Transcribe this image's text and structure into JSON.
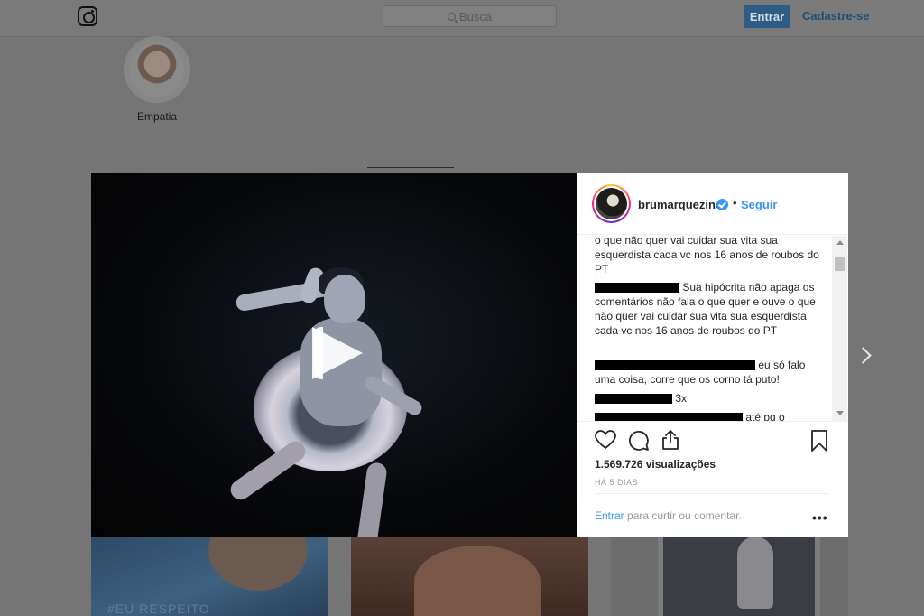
{
  "header": {
    "search_placeholder": "Busca",
    "login_label": "Entrar",
    "signup_label": "Cadastre-se"
  },
  "highlight": {
    "label": "Empatia"
  },
  "post": {
    "username": "brumarquezine",
    "separator": "•",
    "follow_label": "Seguir",
    "comments": [
      {
        "text": "o que não quer vai cuidar sua vita sua esquerdista cada vc nos 16 anos de roubos do PT"
      },
      {
        "text": "Sua hipócrita não apaga os comentários não fala o que quer e ouve o que não quer vai cuidar sua vita sua esquerdista cada vc nos 16 anos de roubos do PT"
      },
      {
        "text": "eu só falo uma coisa, corre que os corno tá puto!"
      },
      {
        "text": "3x"
      },
      {
        "text": "até pq o"
      }
    ],
    "views": "1.569.726 visualizações",
    "date": "HÁ 5 DIAS",
    "login_prompt_link": "Entrar",
    "login_prompt_rest": "para curtir ou comentar.",
    "more_label": "•••"
  },
  "thumbnails": [
    {
      "caption": "#EU RESPEITO"
    }
  ]
}
